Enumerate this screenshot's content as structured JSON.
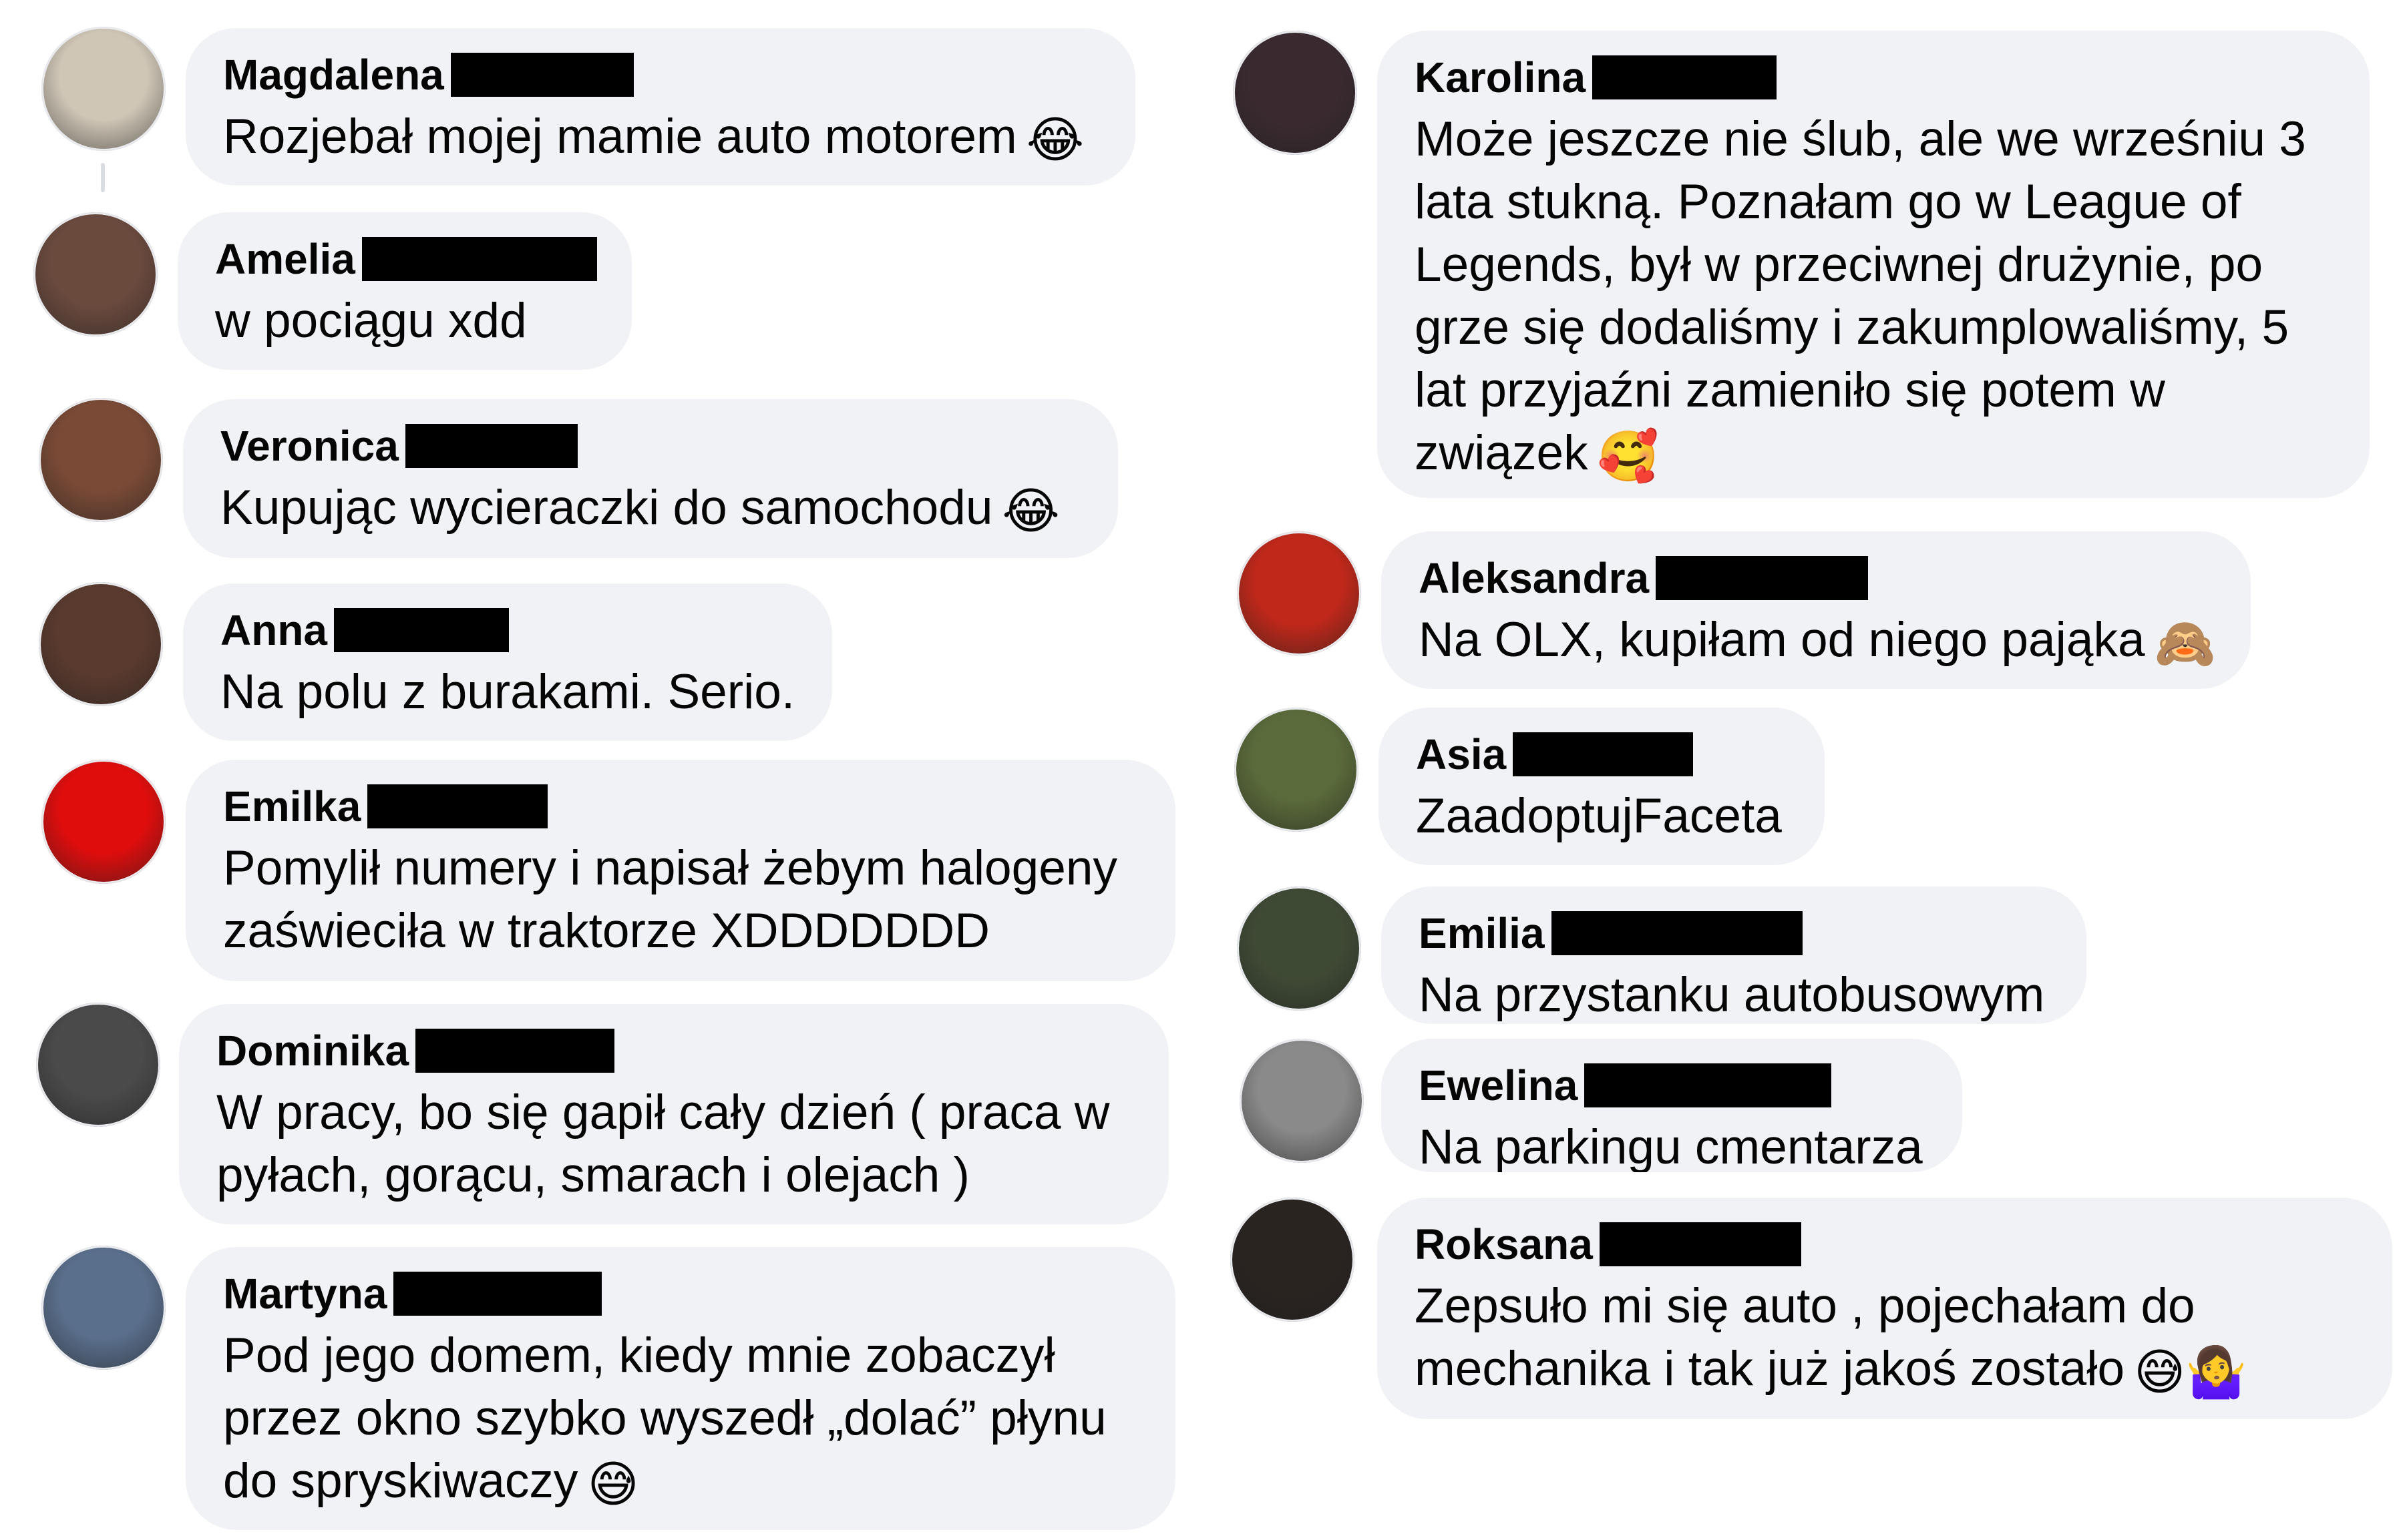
{
  "comments": [
    {
      "name": "Magdalena",
      "text": "Rozjebał mojej mamie auto motorem",
      "emoji": "😂",
      "emoji_icon": "laughing-tears-emoji-icon",
      "avatar_color": "#cfc6b6"
    },
    {
      "name": "Amelia",
      "text": "w pociągu xdd",
      "emoji": "",
      "avatar_color": "#6b4a3e"
    },
    {
      "name": "Veronica",
      "text": "Kupując wycieraczki do samochodu",
      "emoji": "😂",
      "emoji_icon": "laughing-tears-emoji-icon",
      "avatar_color": "#7a4a36"
    },
    {
      "name": "Anna",
      "text": "Na polu z burakami. Serio.",
      "emoji": "",
      "avatar_color": "#5a3a2e"
    },
    {
      "name": "Emilka",
      "text": "Pomylił numery i napisał żebym halogeny\nzaświeciła w traktorze XDDDDDDD",
      "emoji": "",
      "avatar_color": "#e00d0d"
    },
    {
      "name": "Dominika",
      "text": "W pracy, bo się gapił cały dzień ( praca w\npyłach, gorącu, smarach i olejach )",
      "emoji": "",
      "avatar_color": "#4a4a4a"
    },
    {
      "name": "Martyna",
      "text": "Pod jego domem, kiedy mnie zobaczył\nprzez okno szybko wyszedł „dolać” płynu\ndo spryskiwaczy",
      "emoji": "😅",
      "emoji_icon": "grinning-sweat-emoji-icon",
      "avatar_color": "#5a6f8c"
    },
    {
      "name": "Karolina",
      "text": "Może jeszcze nie ślub, ale we wrześniu 3\nlata stukną. Poznałam go w League of\nLegends, był w przeciwnej drużynie, po\ngrze się dodaliśmy i zakumplowaliśmy, 5\nlat przyjaźni zamieniło się potem w\nzwiązek",
      "emoji": "🥰",
      "emoji_icon": "smiling-hearts-emoji-icon",
      "avatar_color": "#3a2a30"
    },
    {
      "name": "Aleksandra",
      "text": "Na OLX, kupiłam od niego pająka",
      "emoji": "🙈",
      "emoji_icon": "see-no-evil-monkey-emoji-icon",
      "avatar_color": "#c0281a"
    },
    {
      "name": "Asia",
      "text": "ZaadoptujFaceta",
      "emoji": "",
      "avatar_color": "#5a6a3a"
    },
    {
      "name": "Emilia",
      "text": "Na przystanku autobusowym",
      "emoji": "",
      "avatar_color": "#3f4a35"
    },
    {
      "name": "Ewelina",
      "text": "Na parkingu cmentarza",
      "emoji": "",
      "avatar_color": "#8a8a8a"
    },
    {
      "name": "Roksana",
      "text": "Zepsuło mi się auto , pojechałam do\nmechanika i tak już jakoś zostało",
      "emoji": "😅🤷‍♀️",
      "emoji_icon": "grinning-sweat-and-shrug-emoji-icon",
      "avatar_color": "#2a2420"
    }
  ]
}
